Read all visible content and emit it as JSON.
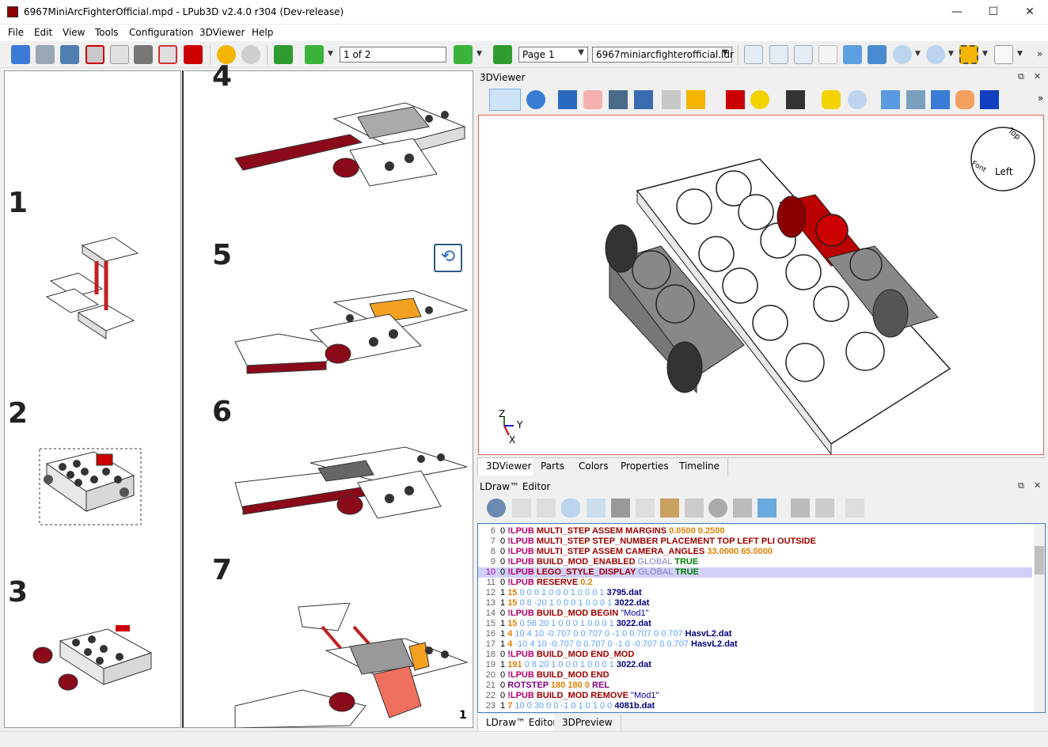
{
  "window": {
    "title": "6967MiniArcFighterOfficial.mpd - LPub3D v2.4.0 r304 (Dev-release)",
    "minimize": "—",
    "maximize": "☐",
    "close": "✕"
  },
  "menu": [
    "File",
    "Edit",
    "View",
    "Tools",
    "Configuration",
    "3DViewer",
    "Help"
  ],
  "toolbar": {
    "page_field": "1 of 2",
    "page_combo": "Page 1",
    "file_combo": "6967miniarcfighterofficial.ldr"
  },
  "pages": {
    "left_steps": [
      "1",
      "2",
      "3"
    ],
    "right_steps": [
      "4",
      "5",
      "6",
      "7"
    ],
    "page_number": "1"
  },
  "viewer": {
    "title": "3DViewer",
    "tabs": [
      "3DViewer",
      "Parts",
      "Colors",
      "Properties",
      "Timeline"
    ],
    "active_tab": "3DViewer",
    "viewsphere": {
      "top": "Top",
      "left": "Left",
      "front": "Font"
    },
    "axes": {
      "z": "Z",
      "y": "Y",
      "x": "X"
    }
  },
  "editor": {
    "title": "LDraw™ Editor",
    "tabs": [
      "LDraw™ Editor",
      "3DPreview"
    ],
    "active_tab": "LDraw™ Editor",
    "current_line": "10",
    "lines": [
      {
        "n": "6",
        "t": [
          [
            "c0",
            "0 "
          ],
          [
            "ckw",
            "!LPUB "
          ],
          [
            "cred",
            "MULTI_STEP ASSEM MARGINS "
          ],
          [
            "corange",
            "0.0500 0.2500"
          ]
        ]
      },
      {
        "n": "7",
        "t": [
          [
            "c0",
            "0 "
          ],
          [
            "ckw",
            "!LPUB "
          ],
          [
            "cred",
            "MULTI_STEP STEP_NUMBER PLACEMENT TOP LEFT PLI OUTSIDE"
          ]
        ]
      },
      {
        "n": "8",
        "t": [
          [
            "c0",
            "0 "
          ],
          [
            "ckw",
            "!LPUB "
          ],
          [
            "cred",
            "MULTI_STEP ASSEM CAMERA_ANGLES "
          ],
          [
            "corange",
            "33.0000 65.0000"
          ]
        ]
      },
      {
        "n": "9",
        "t": [
          [
            "c0",
            "0 "
          ],
          [
            "ckw",
            "!LPUB "
          ],
          [
            "cred",
            "BUILD_MOD_ENABLED "
          ],
          [
            "cgray",
            "GLOBAL "
          ],
          [
            "cbool",
            "TRUE"
          ]
        ]
      },
      {
        "n": "10",
        "t": [
          [
            "c0",
            "0 "
          ],
          [
            "ckw",
            "!LPUB "
          ],
          [
            "cred",
            "LEGO_STYLE_DISPLAY "
          ],
          [
            "cgray",
            "GLOBAL "
          ],
          [
            "cbool",
            "TRUE"
          ]
        ]
      },
      {
        "n": "11",
        "t": [
          [
            "c0",
            "0 "
          ],
          [
            "ckw",
            "!LPUB "
          ],
          [
            "cred",
            "RESERVE "
          ],
          [
            "corange",
            "0.2"
          ]
        ]
      },
      {
        "n": "12",
        "t": [
          [
            "c0",
            "1 "
          ],
          [
            "corange",
            "15 "
          ],
          [
            "cnum",
            "0 0 0 1 0 0 0 1 0 0 0 1 "
          ],
          [
            "cblue",
            "3795.dat"
          ]
        ]
      },
      {
        "n": "13",
        "t": [
          [
            "c0",
            "1 "
          ],
          [
            "corange",
            "15 "
          ],
          [
            "cnum",
            "0 8 -20 1 0 0 0 1 0 0 0 1 "
          ],
          [
            "cblue",
            "3022.dat"
          ]
        ]
      },
      {
        "n": "14",
        "t": [
          [
            "c0",
            "0 "
          ],
          [
            "ckw",
            "!LPUB "
          ],
          [
            "cred",
            "BUILD_MOD BEGIN "
          ],
          [
            "cstr",
            "\"Mod1\""
          ]
        ]
      },
      {
        "n": "15",
        "t": [
          [
            "c0",
            "1 "
          ],
          [
            "corange",
            "15 "
          ],
          [
            "cnum",
            "0 56 20 1 0 0 0 1 0 0 0 1 "
          ],
          [
            "cblue",
            "3022.dat"
          ]
        ]
      },
      {
        "n": "16",
        "t": [
          [
            "c0",
            "1 "
          ],
          [
            "corange",
            "4 "
          ],
          [
            "cnum",
            "10 4 10 -0.707 0 0.707 0 -1 0 0.707 0 0.707 "
          ],
          [
            "cblue",
            "HasvL2.dat"
          ]
        ]
      },
      {
        "n": "17",
        "t": [
          [
            "c0",
            "1 "
          ],
          [
            "corange",
            "4 "
          ],
          [
            "cnum",
            "-10 4 10 -0.707 0 0.707 0 -1 0 -0.707 0 0.707 "
          ],
          [
            "cblue",
            "HasvL2.dat"
          ]
        ]
      },
      {
        "n": "18",
        "t": [
          [
            "c0",
            "0 "
          ],
          [
            "ckw",
            "!LPUB "
          ],
          [
            "cred",
            "BUILD_MOD END_MOD"
          ]
        ]
      },
      {
        "n": "19",
        "t": [
          [
            "c0",
            "1 "
          ],
          [
            "corange",
            "191 "
          ],
          [
            "cnum",
            "0 8 20 1 0 0 0 1 0 0 0 1 "
          ],
          [
            "cblue",
            "3022.dat"
          ]
        ]
      },
      {
        "n": "20",
        "t": [
          [
            "c0",
            "0 "
          ],
          [
            "ckw",
            "!LPUB "
          ],
          [
            "cred",
            "BUILD_MOD END"
          ]
        ]
      },
      {
        "n": "21",
        "t": [
          [
            "c0",
            "0 "
          ],
          [
            "cpurple",
            "ROTSTEP "
          ],
          [
            "corange",
            "180 180 0 "
          ],
          [
            "cpurple",
            "REL"
          ]
        ]
      },
      {
        "n": "22",
        "t": [
          [
            "c0",
            "0 "
          ],
          [
            "ckw",
            "!LPUB "
          ],
          [
            "cred",
            "BUILD_MOD REMOVE "
          ],
          [
            "cstr",
            "\"Mod1\""
          ]
        ]
      },
      {
        "n": "23",
        "t": [
          [
            "c0",
            "1 "
          ],
          [
            "corange",
            "7 "
          ],
          [
            "cnum",
            "10 0 30 0 0 -1 0 1 0 1 0 0 "
          ],
          [
            "cblue",
            "4081b.dat"
          ]
        ]
      }
    ]
  }
}
